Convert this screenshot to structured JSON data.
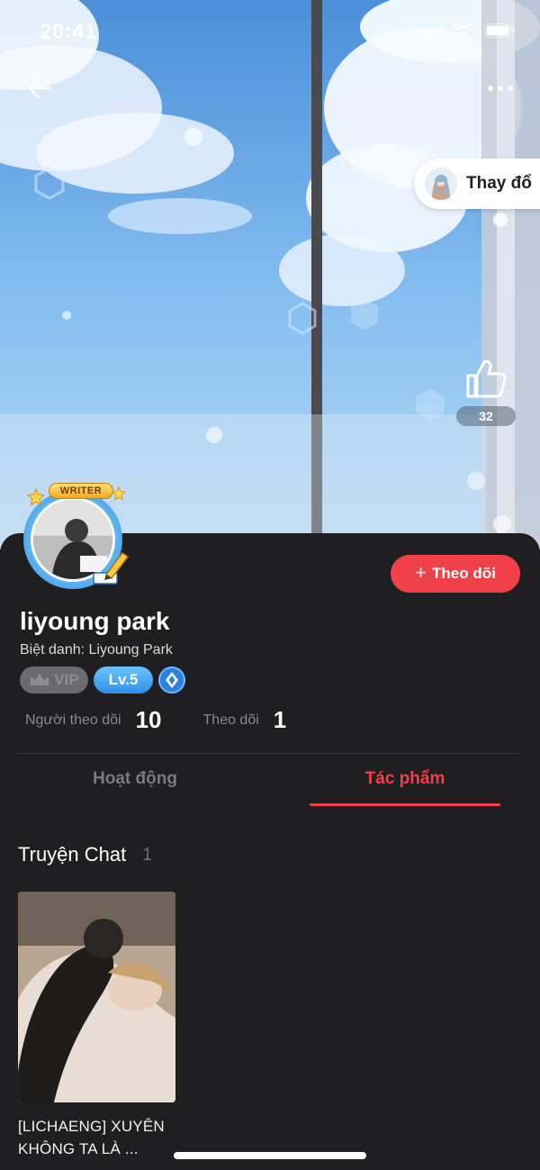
{
  "status_bar": {
    "time": "20:41"
  },
  "hero": {
    "change_button_label": "Thay đổ",
    "like_count": "32"
  },
  "profile": {
    "writer_badge": "WRITER",
    "follow_label": "Theo dõi",
    "username": "liyoung park",
    "nickname": "Biệt danh: Liyoung Park",
    "vip_label": "VIP",
    "level_label": "Lv.5",
    "followers_label": "Người theo dõi",
    "followers_count": "10",
    "following_label": "Theo dõi",
    "following_count": "1"
  },
  "tabs": [
    {
      "label": "Hoạt động",
      "active": false
    },
    {
      "label": "Tác phẩm",
      "active": true
    }
  ],
  "section": {
    "title": "Truyện Chat",
    "count": "1"
  },
  "stories": [
    {
      "title": "[LICHAENG] XUYÊN KHÔNG TA LÀ ..."
    }
  ],
  "colors": {
    "accent": "#f0414b",
    "background": "#1f1f21",
    "level_badge": "#2f8fe8",
    "sky": "#6aa8e6"
  }
}
